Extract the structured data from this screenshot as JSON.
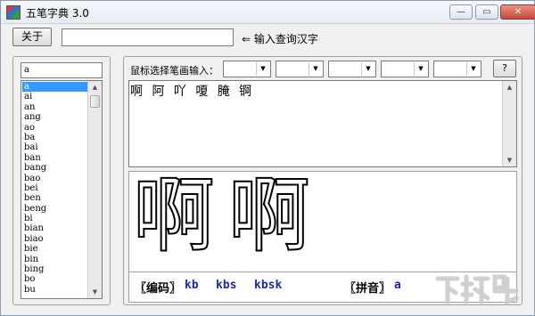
{
  "window": {
    "title": "五笔字典 3.0",
    "minimize_glyph": "—",
    "maximize_glyph": "▭",
    "close_glyph": "✕"
  },
  "toolbar": {
    "about_label": "关于",
    "search_value": "",
    "search_hint": "⇐ 输入查询汉字"
  },
  "pinyin_panel": {
    "filter_value": "a",
    "items": [
      "a",
      "ai",
      "an",
      "ang",
      "ao",
      "ba",
      "bai",
      "ban",
      "bang",
      "bao",
      "bei",
      "ben",
      "beng",
      "bi",
      "bian",
      "biao",
      "bie",
      "bin",
      "bing",
      "bo",
      "bu"
    ],
    "selected_index": 0
  },
  "stroke_input": {
    "label": "鼠标选择笔画输入：",
    "help_label": "?",
    "dropdowns": [
      "",
      "",
      "",
      "",
      ""
    ]
  },
  "candidates": {
    "text": "啊 阿 吖 嗄 腌 锕"
  },
  "preview": {
    "char_left": "啊",
    "char_right": "啊"
  },
  "info": {
    "code_label": "〖编码〗",
    "codes": [
      "kb",
      "kbs",
      "kbsk"
    ],
    "pinyin_label": "〖拼音〗",
    "pinyin_value": "a"
  },
  "watermark_text": "下载吧",
  "colors": {
    "selection": "#3399ff",
    "code_blue": "#1d2aa8",
    "close_red": "#c74a3a"
  }
}
